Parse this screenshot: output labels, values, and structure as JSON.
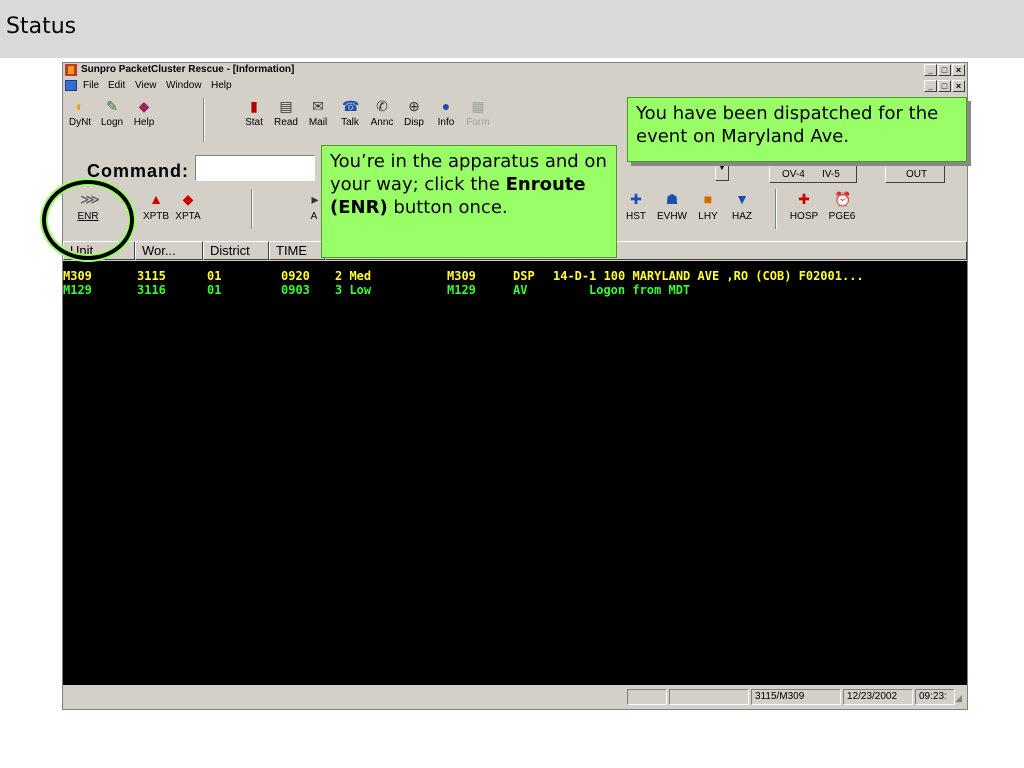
{
  "slide": {
    "title": "Status"
  },
  "window": {
    "title": "Sunpro PacketCluster Rescue - [Information]",
    "controls": [
      "_",
      "□",
      "×"
    ]
  },
  "menu": [
    "File",
    "Edit",
    "View",
    "Window",
    "Help"
  ],
  "toolbar1": [
    {
      "label": "DyNt",
      "icon": "globe-icon"
    },
    {
      "label": "Logn",
      "icon": "logon-icon"
    },
    {
      "label": "Help",
      "icon": "help-icon"
    },
    {
      "label": "Stat",
      "icon": "stat-icon"
    },
    {
      "label": "Read",
      "icon": "read-icon"
    },
    {
      "label": "Mail",
      "icon": "mail-icon"
    },
    {
      "label": "Talk",
      "icon": "talk-icon"
    },
    {
      "label": "Annc",
      "icon": "announce-icon"
    },
    {
      "label": "Disp",
      "icon": "dispatch-icon"
    },
    {
      "label": "Info",
      "icon": "info-icon"
    },
    {
      "label": "Form",
      "icon": "form-icon"
    }
  ],
  "command": {
    "label": "Command:",
    "value": ""
  },
  "status_buttons": [
    "OV-4",
    "IV-5",
    "OUT"
  ],
  "toolbar2": [
    {
      "label": "ENR",
      "icon": "enroute-icon"
    },
    {
      "label": "",
      "icon": "onscene-icon"
    },
    {
      "label": "XPTB",
      "icon": "transport-b-icon"
    },
    {
      "label": "XPTA",
      "icon": "transport-a-icon"
    },
    {
      "label": "A",
      "icon": "available-icon"
    },
    {
      "label": "HST",
      "icon": "hospital-status-icon"
    },
    {
      "label": "EVHW",
      "icon": "evhw-icon"
    },
    {
      "label": "LHY",
      "icon": "lhy-icon"
    },
    {
      "label": "HAZ",
      "icon": "hazard-icon"
    },
    {
      "label": "HOSP",
      "icon": "hospital-icon"
    },
    {
      "label": "PGE6",
      "icon": "page-icon"
    }
  ],
  "columns": [
    "Unit",
    "Wor...",
    "District",
    "TIME"
  ],
  "rows": [
    {
      "unit": "M309",
      "wor": "3115",
      "district": "01",
      "time": "0920",
      "priority": "2 Med",
      "unit2": "M309",
      "status": "DSP",
      "info": "14-D-1  100 MARYLAND AVE ,RO (COB)  F02001...",
      "color": "#ffff33"
    },
    {
      "unit": "M129",
      "wor": "3116",
      "district": "01",
      "time": "0903",
      "priority": "3 Low",
      "unit2": "M129",
      "status": "AV",
      "info": "Logon from MDT",
      "color": "#33ff33"
    }
  ],
  "statusbar": {
    "unit_info": "3115/M309",
    "date": "12/23/2002",
    "time": "09:23:"
  },
  "callouts": {
    "top": "You have been dispatched for the event on Maryland Ave.",
    "middle_pre": "You’re in the apparatus and on your way; click the ",
    "middle_bold": "Enroute (ENR)",
    "middle_post": " button once."
  }
}
